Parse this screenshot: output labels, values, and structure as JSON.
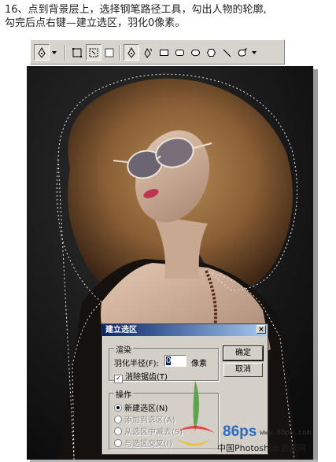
{
  "caption": {
    "line1": "16、点到背景层上，选择钢笔路径工具，勾出人物的轮廓,",
    "line2": "勾完后点右键—建立选区，羽化0像素。"
  },
  "toolbar": {
    "tools": [
      "pen-tool-icon",
      "dropdown-arrow-icon",
      "shape-layers-icon",
      "paths-icon",
      "fill-pixels-icon",
      "pen-icon",
      "freeform-pen-icon",
      "rectangle-icon",
      "rounded-rectangle-icon",
      "ellipse-icon",
      "polygon-icon",
      "line-icon",
      "custom-shape-icon",
      "dropdown-arrow-icon"
    ]
  },
  "dialog": {
    "title": "建立选区",
    "close_glyph": "×",
    "render_group": "渲染",
    "feather_label": "羽化半径(F):",
    "feather_value": "0",
    "feather_unit": "像素",
    "antialias_label": "消除锯齿(T)",
    "antialias_checked": true,
    "operation_group": "操作",
    "op_new": "新建选区(N)",
    "op_add": "添加到选区(A)",
    "op_subtract": "从选区中减去(S)",
    "op_intersect": "与选区交叉(I)",
    "ok_label": "确定",
    "cancel_label": "取消"
  },
  "watermark": {
    "url": "www.86ps.com",
    "brand": "86ps",
    "site": "中国Photoshop资源网"
  },
  "colors": {
    "accent": "#0a246a",
    "dialog_bg": "#d4d0c8",
    "toolbar_bg": "#d7d4cd"
  }
}
